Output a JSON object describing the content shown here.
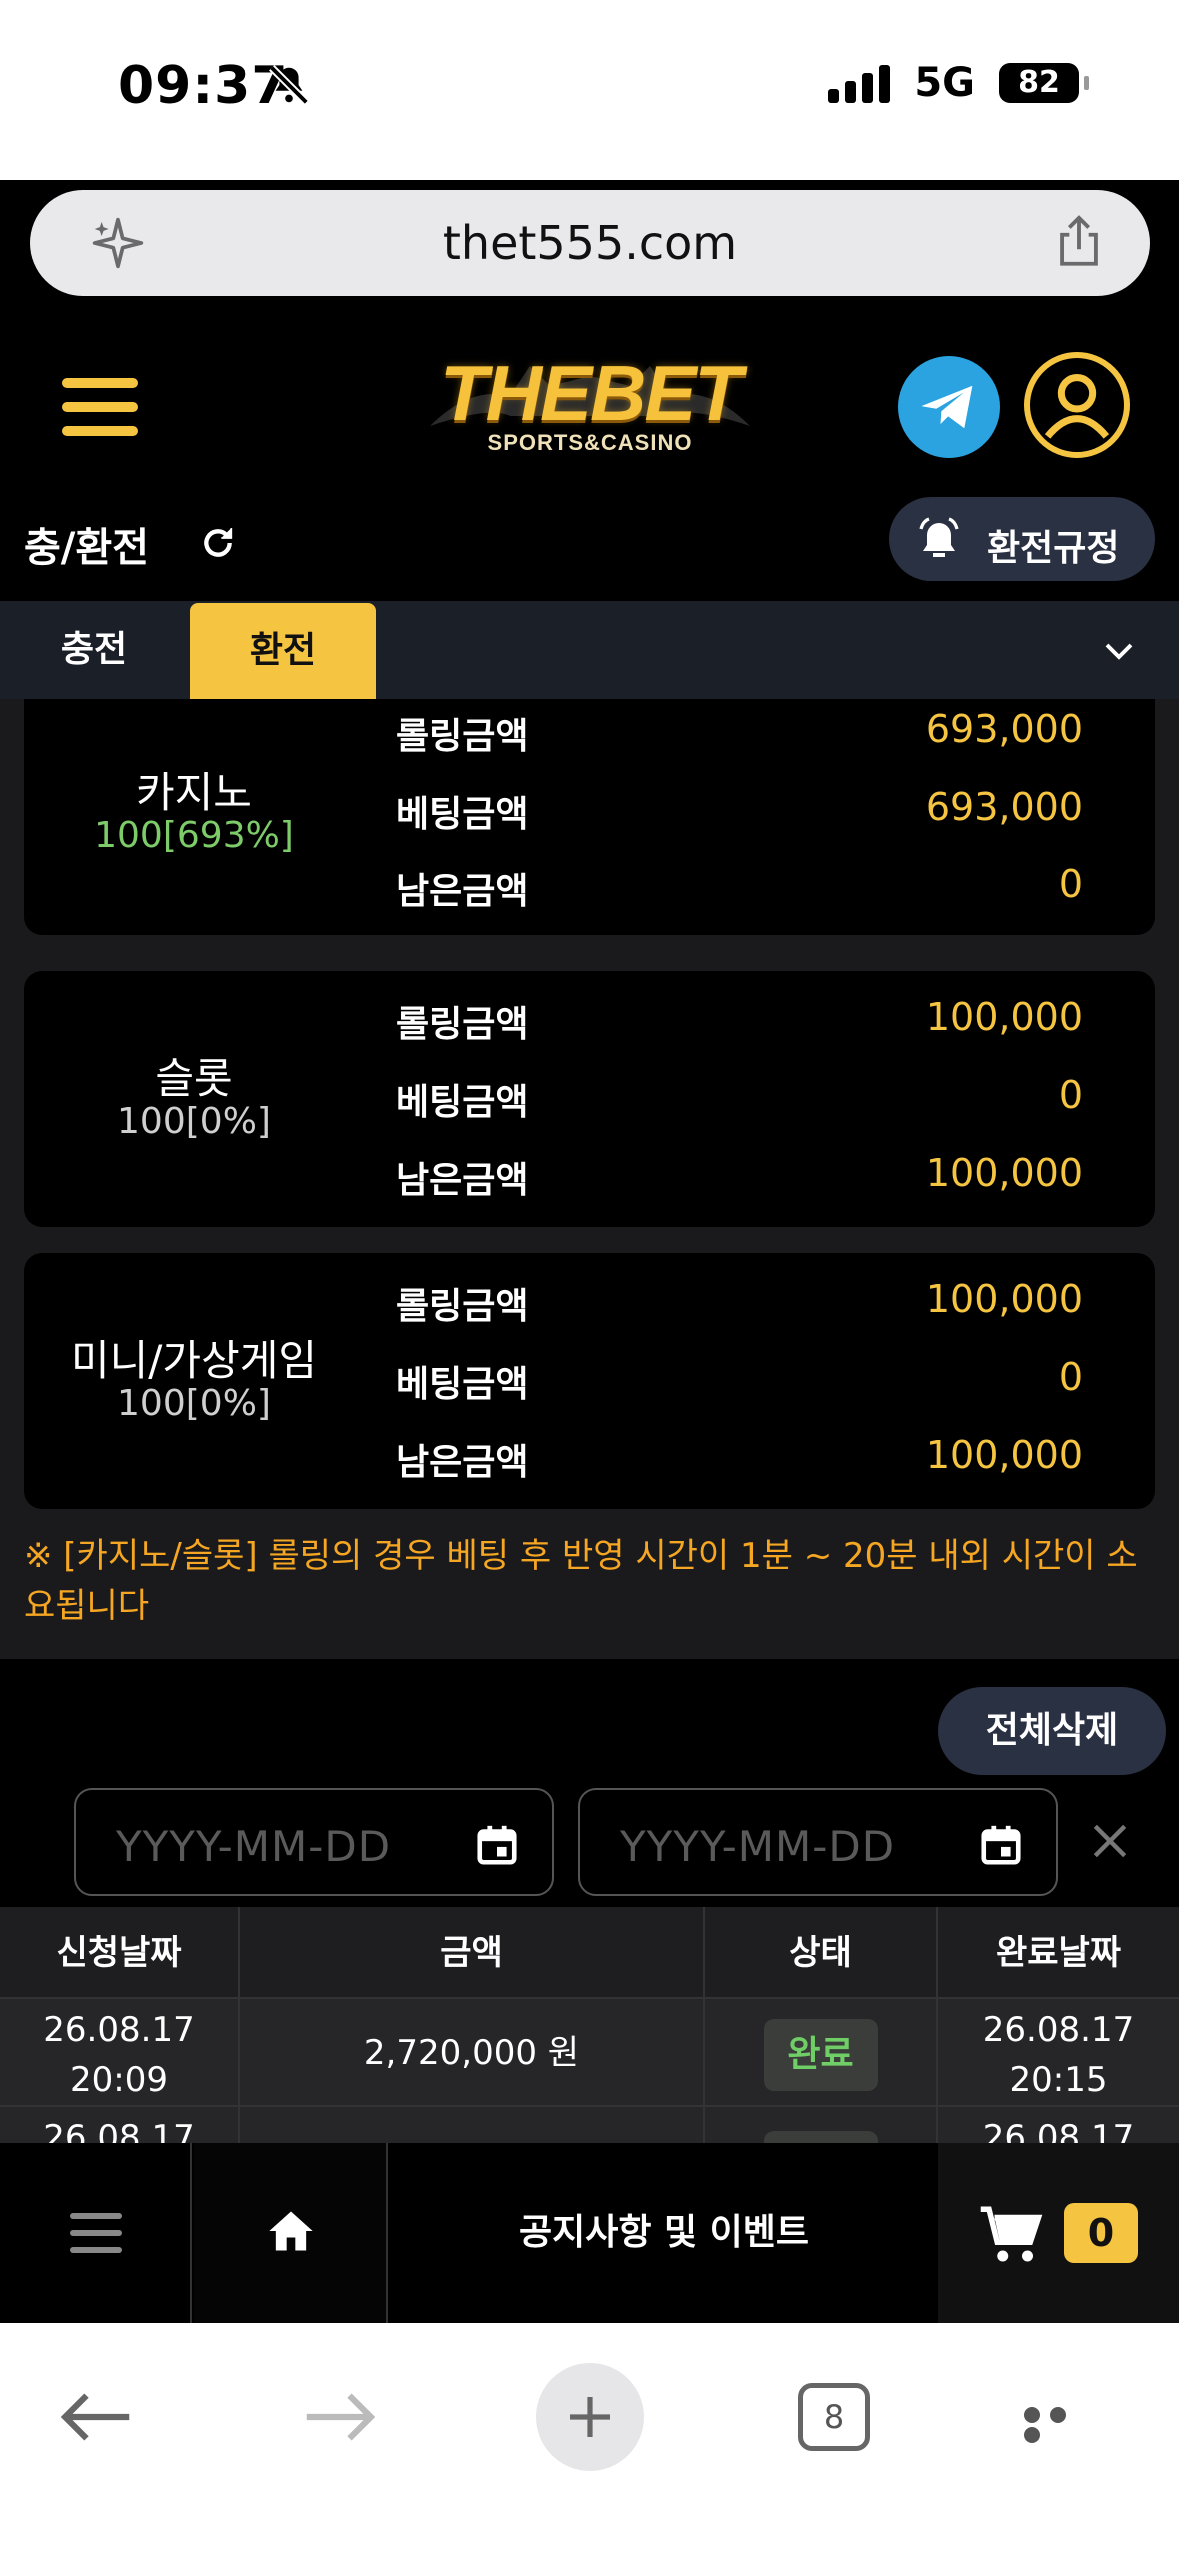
{
  "status_bar": {
    "time": "09:37",
    "network": "5G",
    "battery": "82"
  },
  "browser": {
    "url": "thet555.com",
    "tab_count": "8"
  },
  "header": {
    "logo_main": "THEBET",
    "logo_sub": "SPORTS&CASINO"
  },
  "title_row": {
    "title": "충/환전",
    "rules_button": "환전규정"
  },
  "tabs": [
    {
      "label": "충전",
      "active": false
    },
    {
      "label": "환전",
      "active": true
    }
  ],
  "row_labels": {
    "rolling": "롤링금액",
    "betting": "베팅금액",
    "remaining": "남은금액"
  },
  "cards": [
    {
      "name": "카지노",
      "percent": "100[693%]",
      "percent_color": "#7ecb6a",
      "rolling": "693,000",
      "betting": "693,000",
      "remaining": "0"
    },
    {
      "name": "슬롯",
      "percent": "100[0%]",
      "percent_color": "#cfcfcf",
      "rolling": "100,000",
      "betting": "0",
      "remaining": "100,000"
    },
    {
      "name": "미니/가상게임",
      "percent": "100[0%]",
      "percent_color": "#cfcfcf",
      "rolling": "100,000",
      "betting": "0",
      "remaining": "100,000"
    }
  ],
  "notice_text": "※ [카지노/슬롯] 롤링의 경우 베팅 후 반영 시간이 1분 ~ 20분 내외 시간이 소요됩니다",
  "history": {
    "delete_all_label": "전체삭제",
    "date_from_placeholder": "YYYY-MM-DD",
    "date_to_placeholder": "YYYY-MM-DD",
    "columns": [
      "신청날짜",
      "금액",
      "상태",
      "완료날짜"
    ],
    "rows": [
      {
        "request_date": "26.08.17",
        "request_time": "20:09",
        "amount": "2,720,000 원",
        "status": "완료",
        "complete_date": "26.08.17",
        "complete_time": "20:15"
      },
      {
        "request_date": "26.08.17",
        "request_time": "",
        "amount": "",
        "status": "",
        "complete_date": "26.08.17",
        "complete_time": ""
      }
    ]
  },
  "bottom_bar": {
    "notice_label": "공지사항 및 이벤트",
    "cart_count": "0"
  },
  "colors": {
    "accent": "#f5c542",
    "value": "#f5c542",
    "notice": "#f5a623",
    "status_done": "#6fcf66"
  }
}
